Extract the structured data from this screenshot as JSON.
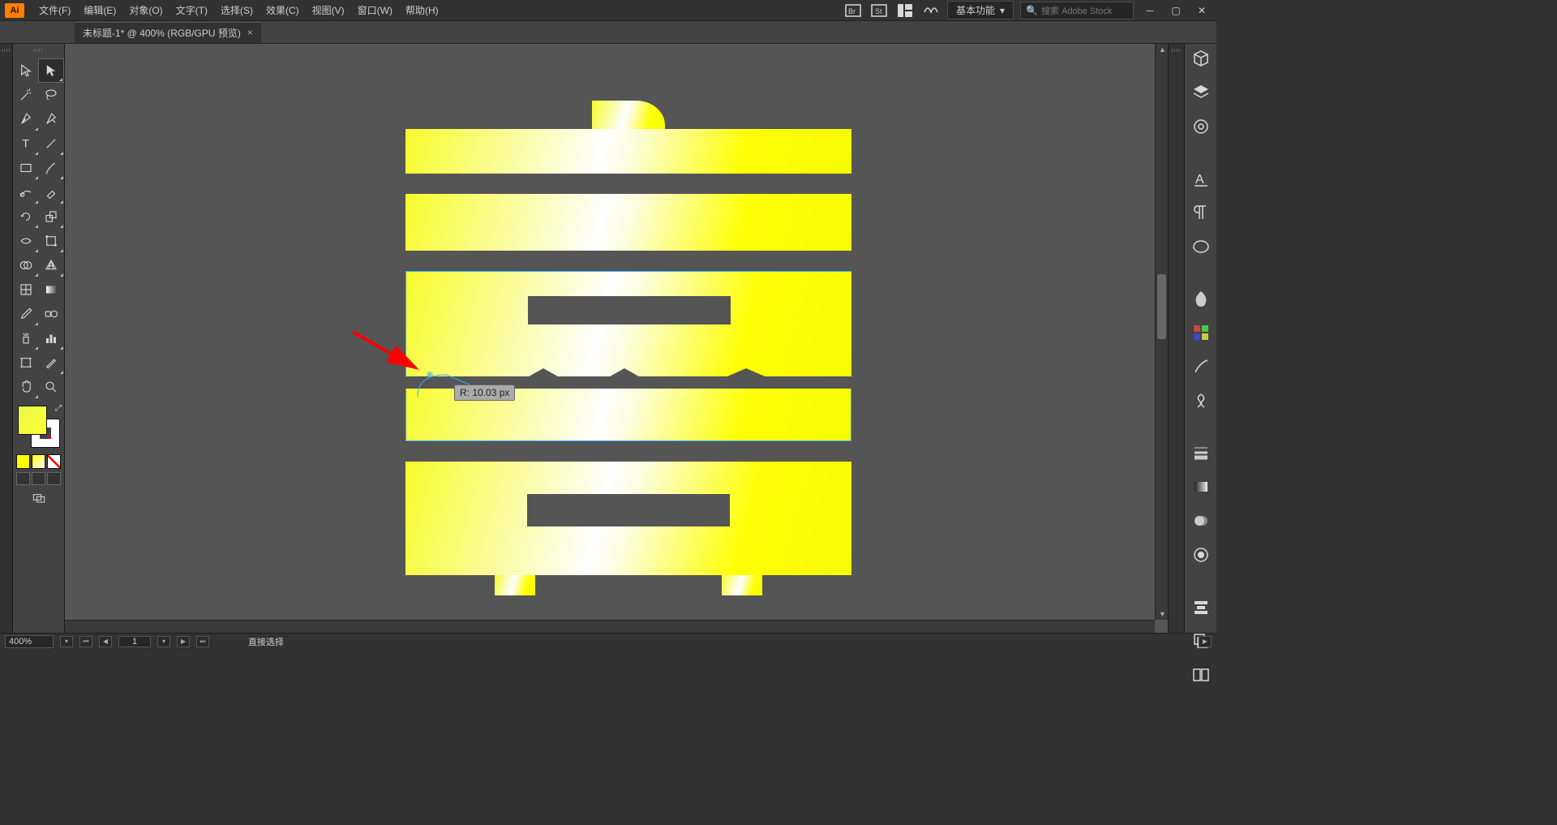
{
  "app": {
    "logo": "Ai"
  },
  "menu": {
    "file": "文件(F)",
    "edit": "编辑(E)",
    "object": "对象(O)",
    "type": "文字(T)",
    "select": "选择(S)",
    "effect": "效果(C)",
    "view": "视图(V)",
    "window": "窗口(W)",
    "help": "帮助(H)"
  },
  "workspace": {
    "label": "基本功能"
  },
  "search": {
    "placeholder": "搜索 Adobe Stock"
  },
  "document": {
    "tab_title": "未标题-1* @ 400% (RGB/GPU 预览)"
  },
  "tooltip": {
    "radius_label": "R: 10.03 px"
  },
  "status": {
    "zoom": "400%",
    "artboard": "1",
    "tool": "直接选择"
  },
  "colors": {
    "gradient_start": "#f7fb2a",
    "gradient_highlight": "#ffffff",
    "gradient_end": "#feff05",
    "selection_outline": "#3399ff",
    "annotation_arrow": "#ff0000"
  },
  "right_icons": [
    "3d-icon",
    "layers-icon",
    "cc-libraries-icon",
    "character-icon",
    "paragraph-icon",
    "opentype-icon",
    "color-icon",
    "swatches-icon",
    "symbols-icon",
    "brushes-icon",
    "stroke-icon",
    "gradient-icon",
    "transparency-icon",
    "appearance-icon",
    "align-icon",
    "pathfinder-icon",
    "artboards-icon"
  ]
}
